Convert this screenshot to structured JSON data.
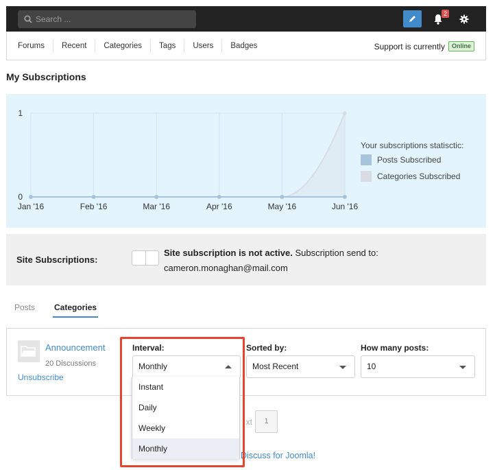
{
  "topbar": {
    "search_placeholder": "Search ...",
    "notification_count": "2"
  },
  "nav": {
    "items": [
      "Forums",
      "Recent",
      "Categories",
      "Tags",
      "Users",
      "Badges"
    ],
    "support_text": "Support is currently",
    "support_status": "Online"
  },
  "page": {
    "title": "My Subscriptions"
  },
  "chart_data": {
    "type": "area",
    "categories": [
      "Jan '16",
      "Feb '16",
      "Mar '16",
      "Apr '16",
      "May '16",
      "Jun '16"
    ],
    "series": [
      {
        "name": "Posts Subscribed",
        "values": [
          0,
          0,
          0,
          0,
          0,
          0
        ],
        "color": "#a8c4dc"
      },
      {
        "name": "Categories Subscribed",
        "values": [
          0,
          0,
          0,
          0,
          0,
          1
        ],
        "color": "#d9dde2"
      }
    ],
    "ylim": [
      0,
      1
    ],
    "yticks": [
      "0",
      "1"
    ],
    "grid": true,
    "legend_title": "Your subscriptions statisctic:",
    "legend_position": "right"
  },
  "site_subscription": {
    "label": "Site Subscriptions:",
    "status_bold": "Site subscription is not active.",
    "status_rest": " Subscription send to:",
    "email": "cameron.monaghan@mail.com"
  },
  "tabs": [
    {
      "label": "Posts",
      "active": false
    },
    {
      "label": "Categories",
      "active": true
    }
  ],
  "category": {
    "name": "Announcement",
    "discussions": "20 Discussions",
    "unsubscribe": "Unsubscribe",
    "interval_label": "Interval:",
    "interval_value": "Monthly",
    "sorted_label": "Sorted by:",
    "sorted_value": "Most Recent",
    "posts_label": "How many posts:",
    "posts_value": "10"
  },
  "dropdown": {
    "options": [
      "Instant",
      "Daily",
      "Weekly",
      "Monthly"
    ],
    "selected": "Monthly"
  },
  "pagination": {
    "partial": "xt",
    "page": "1"
  },
  "footer": {
    "partial": "Discuss for Joomla!"
  },
  "colors": {
    "accent": "#428bca",
    "highlight": "#e8432d",
    "online": "#5cb85c"
  }
}
